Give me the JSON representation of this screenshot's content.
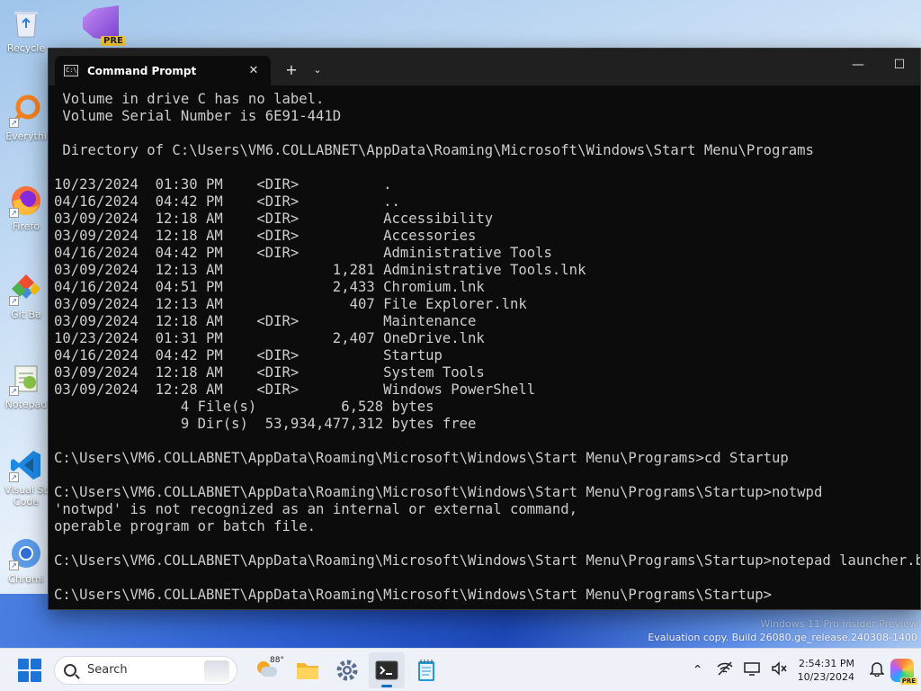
{
  "desktop": {
    "icons": [
      {
        "name": "recycle-bin",
        "label": "Recycle"
      },
      {
        "name": "everything",
        "label": "Everythi"
      },
      {
        "name": "firefox",
        "label": "Firefo"
      },
      {
        "name": "git-bash",
        "label": "Git Ba"
      },
      {
        "name": "notepad",
        "label": "Notepad"
      },
      {
        "name": "vscode",
        "label": "Visual St"
      },
      {
        "name": "vscode-2",
        "label": "Code"
      },
      {
        "name": "chromium",
        "label": "Chromi"
      }
    ],
    "vs_preview_badge": "PRE",
    "watermark": {
      "line1": "Windows 11 Pro Insider Preview",
      "line2": "Evaluation copy. Build 26080.ge_release.240308-1400"
    }
  },
  "terminal": {
    "tab_title": "Command Prompt",
    "tab_close": "✕",
    "new_tab": "+",
    "dropdown": "⌄",
    "minimize": "—",
    "maximize": "☐",
    "lines": [
      " Volume in drive C has no label.",
      " Volume Serial Number is 6E91-441D",
      "",
      " Directory of C:\\Users\\VM6.COLLABNET\\AppData\\Roaming\\Microsoft\\Windows\\Start Menu\\Programs",
      "",
      "10/23/2024  01:30 PM    <DIR>          .",
      "04/16/2024  04:42 PM    <DIR>          ..",
      "03/09/2024  12:18 AM    <DIR>          Accessibility",
      "03/09/2024  12:18 AM    <DIR>          Accessories",
      "04/16/2024  04:42 PM    <DIR>          Administrative Tools",
      "03/09/2024  12:13 AM             1,281 Administrative Tools.lnk",
      "04/16/2024  04:51 PM             2,433 Chromium.lnk",
      "03/09/2024  12:13 AM               407 File Explorer.lnk",
      "03/09/2024  12:18 AM    <DIR>          Maintenance",
      "10/23/2024  01:31 PM             2,407 OneDrive.lnk",
      "04/16/2024  04:42 PM    <DIR>          Startup",
      "03/09/2024  12:18 AM    <DIR>          System Tools",
      "03/09/2024  12:28 AM    <DIR>          Windows PowerShell",
      "               4 File(s)          6,528 bytes",
      "               9 Dir(s)  53,934,477,312 bytes free",
      "",
      "C:\\Users\\VM6.COLLABNET\\AppData\\Roaming\\Microsoft\\Windows\\Start Menu\\Programs>cd Startup",
      "",
      "C:\\Users\\VM6.COLLABNET\\AppData\\Roaming\\Microsoft\\Windows\\Start Menu\\Programs\\Startup>notwpd",
      "'notwpd' is not recognized as an internal or external command,",
      "operable program or batch file.",
      "",
      "C:\\Users\\VM6.COLLABNET\\AppData\\Roaming\\Microsoft\\Windows\\Start Menu\\Programs\\Startup>notepad launcher.bat",
      "",
      "C:\\Users\\VM6.COLLABNET\\AppData\\Roaming\\Microsoft\\Windows\\Start Menu\\Programs\\Startup>"
    ]
  },
  "taskbar": {
    "search_placeholder": "Search",
    "weather_temp": "88°",
    "tray_chevron": "⌃",
    "time": "2:54:31 PM",
    "date": "10/23/2024",
    "copilot_badge": "PRE"
  },
  "colors": {
    "terminal_bg": "#0c0c0c",
    "terminal_fg": "#cccccc",
    "accent": "#0f6cbd"
  }
}
